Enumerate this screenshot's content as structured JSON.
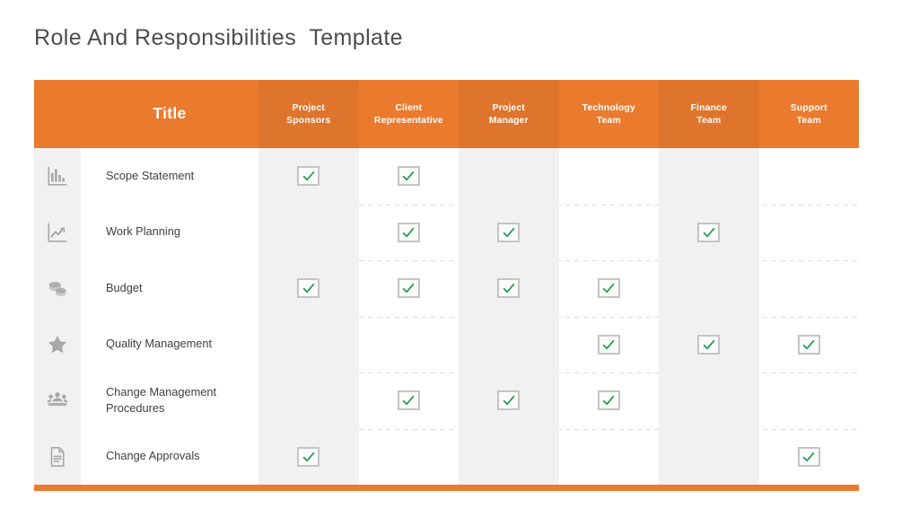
{
  "page_title": "Role And Responsibilities  Template",
  "colors": {
    "header_orange": "#ea7a2e",
    "footer_orange": "#ea7a2e",
    "check_green": "#1f9d4e",
    "checkbox_border": "#c4c4c4",
    "stripe_gray": "#f1f1f1",
    "icon_gray": "#a8a8a8",
    "title_gray": "#4d4d4d",
    "row_text_gray": "#404040"
  },
  "table": {
    "first_column_header": "Title",
    "columns": [
      {
        "label": "Project\nSponsors",
        "name": "project-sponsors",
        "striped": true
      },
      {
        "label": "Client\nRepresentative",
        "name": "client-representative",
        "striped": false
      },
      {
        "label": "Project\nManager",
        "name": "project-manager",
        "striped": true
      },
      {
        "label": "Technology\nTeam",
        "name": "technology-team",
        "striped": false
      },
      {
        "label": "Finance\nTeam",
        "name": "finance-team",
        "striped": true
      },
      {
        "label": "Support\nTeam",
        "name": "support-team",
        "striped": false
      }
    ],
    "rows": [
      {
        "label": "Scope Statement",
        "icon": "bar-chart-icon",
        "checks": [
          true,
          true,
          false,
          false,
          false,
          false
        ]
      },
      {
        "label": "Work Planning",
        "icon": "line-graph-icon",
        "checks": [
          false,
          true,
          true,
          false,
          true,
          false
        ]
      },
      {
        "label": "Budget",
        "icon": "coins-icon",
        "checks": [
          true,
          true,
          true,
          true,
          false,
          false
        ]
      },
      {
        "label": "Quality Management",
        "icon": "star-icon",
        "checks": [
          false,
          false,
          false,
          true,
          true,
          true
        ]
      },
      {
        "label": "Change Management\nProcedures",
        "icon": "people-group-icon",
        "checks": [
          false,
          true,
          true,
          true,
          false,
          false
        ]
      },
      {
        "label": "Change Approvals",
        "icon": "document-icon",
        "checks": [
          true,
          false,
          false,
          false,
          false,
          true
        ]
      }
    ]
  }
}
